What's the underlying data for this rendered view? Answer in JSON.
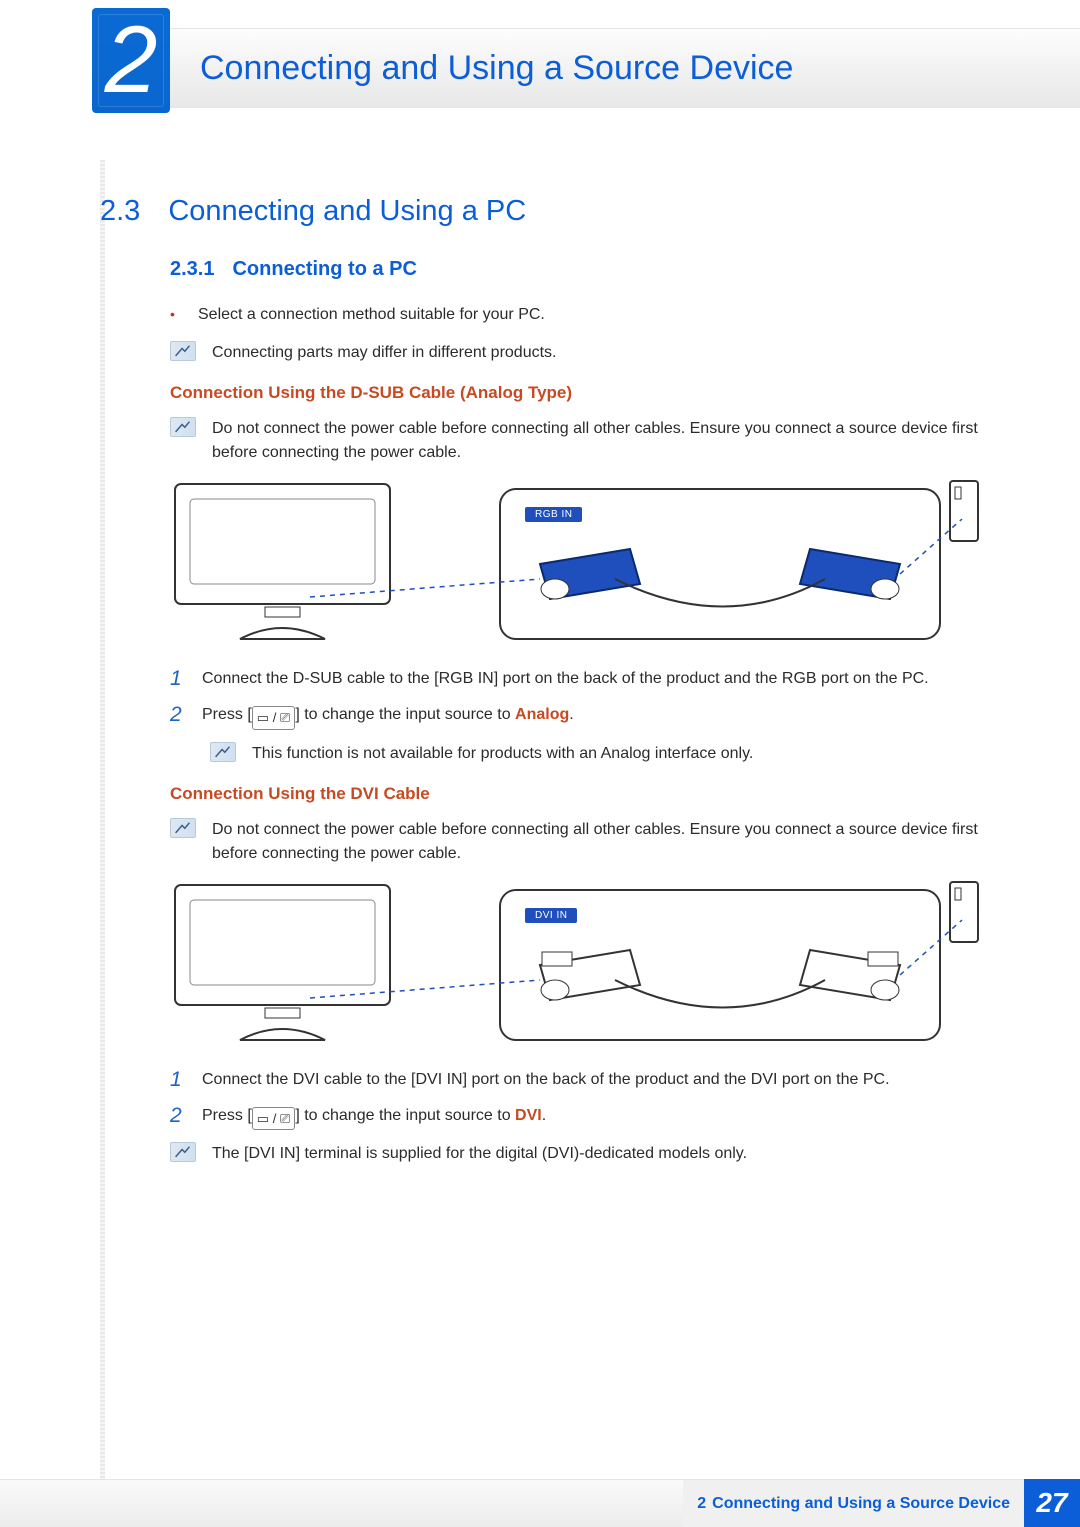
{
  "chapter": {
    "number": "2",
    "title": "Connecting and Using a Source Device"
  },
  "section": {
    "number": "2.3",
    "title": "Connecting and Using a PC"
  },
  "subsection": {
    "number": "2.3.1",
    "title": "Connecting to a PC"
  },
  "intro_bullet": "Select a connection method suitable for your PC.",
  "intro_note": "Connecting parts may differ in different products.",
  "dsub": {
    "heading": "Connection Using the D-SUB Cable (Analog Type)",
    "warning": "Do not connect the power cable before connecting all other cables. Ensure you connect a source device first before connecting the power cable.",
    "port_label": "RGB IN",
    "step1": "Connect the D-SUB cable to the [RGB IN] port on the back of the product and the RGB port on the PC.",
    "step2_a": "Press [",
    "step2_b": "] to change the input source to ",
    "step2_mode": "Analog",
    "step2_c": ".",
    "note": "This function is not available for products with an Analog interface only."
  },
  "dvi": {
    "heading": "Connection Using the DVI Cable",
    "warning": "Do not connect the power cable before connecting all other cables. Ensure you connect a source device first before connecting the power cable.",
    "port_label": "DVI IN",
    "step1": "Connect the DVI cable to the [DVI IN] port on the back of the product and the DVI port on the PC.",
    "step2_a": "Press [",
    "step2_b": "] to change the input source to ",
    "step2_mode": "DVI",
    "step2_c": ".",
    "note": "The [DVI IN] terminal is supplied for the digital (DVI)-dedicated models only."
  },
  "footer": {
    "chapter_num": "2",
    "chapter_title": "Connecting and Using a Source Device",
    "page": "27"
  },
  "step_numbers": {
    "one": "1",
    "two": "2"
  },
  "icons": {
    "source_glyph": "▭ / ⎚"
  }
}
